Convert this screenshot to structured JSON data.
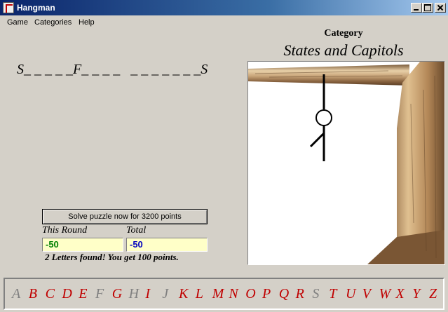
{
  "window": {
    "title": "Hangman"
  },
  "menu": [
    "Game",
    "Categories",
    "Help"
  ],
  "category": {
    "label": "Category",
    "name": "States and Capitols"
  },
  "puzzle": {
    "display": "S_ _ _ _ _F_ _ _ _   _ _ _ _ _ _ _S"
  },
  "solve_button": {
    "label": "Solve puzzle now for 3200 points"
  },
  "score": {
    "round_label": "This Round",
    "round_value": "-50",
    "total_label": "Total",
    "total_value": "-50",
    "round_value_color": "#008000",
    "total_value_color": "#0000c0"
  },
  "message": "2 Letters found! You get 100 points.",
  "colors": {
    "letter_available": "#c00000",
    "letter_used": "#808080"
  },
  "alphabet": [
    {
      "letter": "A",
      "used": true
    },
    {
      "letter": "B",
      "used": false
    },
    {
      "letter": "C",
      "used": false
    },
    {
      "letter": "D",
      "used": false
    },
    {
      "letter": "E",
      "used": false
    },
    {
      "letter": "F",
      "used": true
    },
    {
      "letter": "G",
      "used": false
    },
    {
      "letter": "H",
      "used": true
    },
    {
      "letter": "I",
      "used": false
    },
    {
      "letter": "J",
      "used": true
    },
    {
      "letter": "K",
      "used": false
    },
    {
      "letter": "L",
      "used": false
    },
    {
      "letter": "M",
      "used": false
    },
    {
      "letter": "N",
      "used": false
    },
    {
      "letter": "O",
      "used": false
    },
    {
      "letter": "P",
      "used": false
    },
    {
      "letter": "Q",
      "used": false
    },
    {
      "letter": "R",
      "used": false
    },
    {
      "letter": "S",
      "used": true
    },
    {
      "letter": "T",
      "used": false
    },
    {
      "letter": "U",
      "used": false
    },
    {
      "letter": "V",
      "used": false
    },
    {
      "letter": "W",
      "used": false
    },
    {
      "letter": "X",
      "used": false
    },
    {
      "letter": "Y",
      "used": false
    },
    {
      "letter": "Z",
      "used": false
    }
  ],
  "hangman_parts_drawn": [
    "rope",
    "head",
    "body",
    "left-arm"
  ]
}
